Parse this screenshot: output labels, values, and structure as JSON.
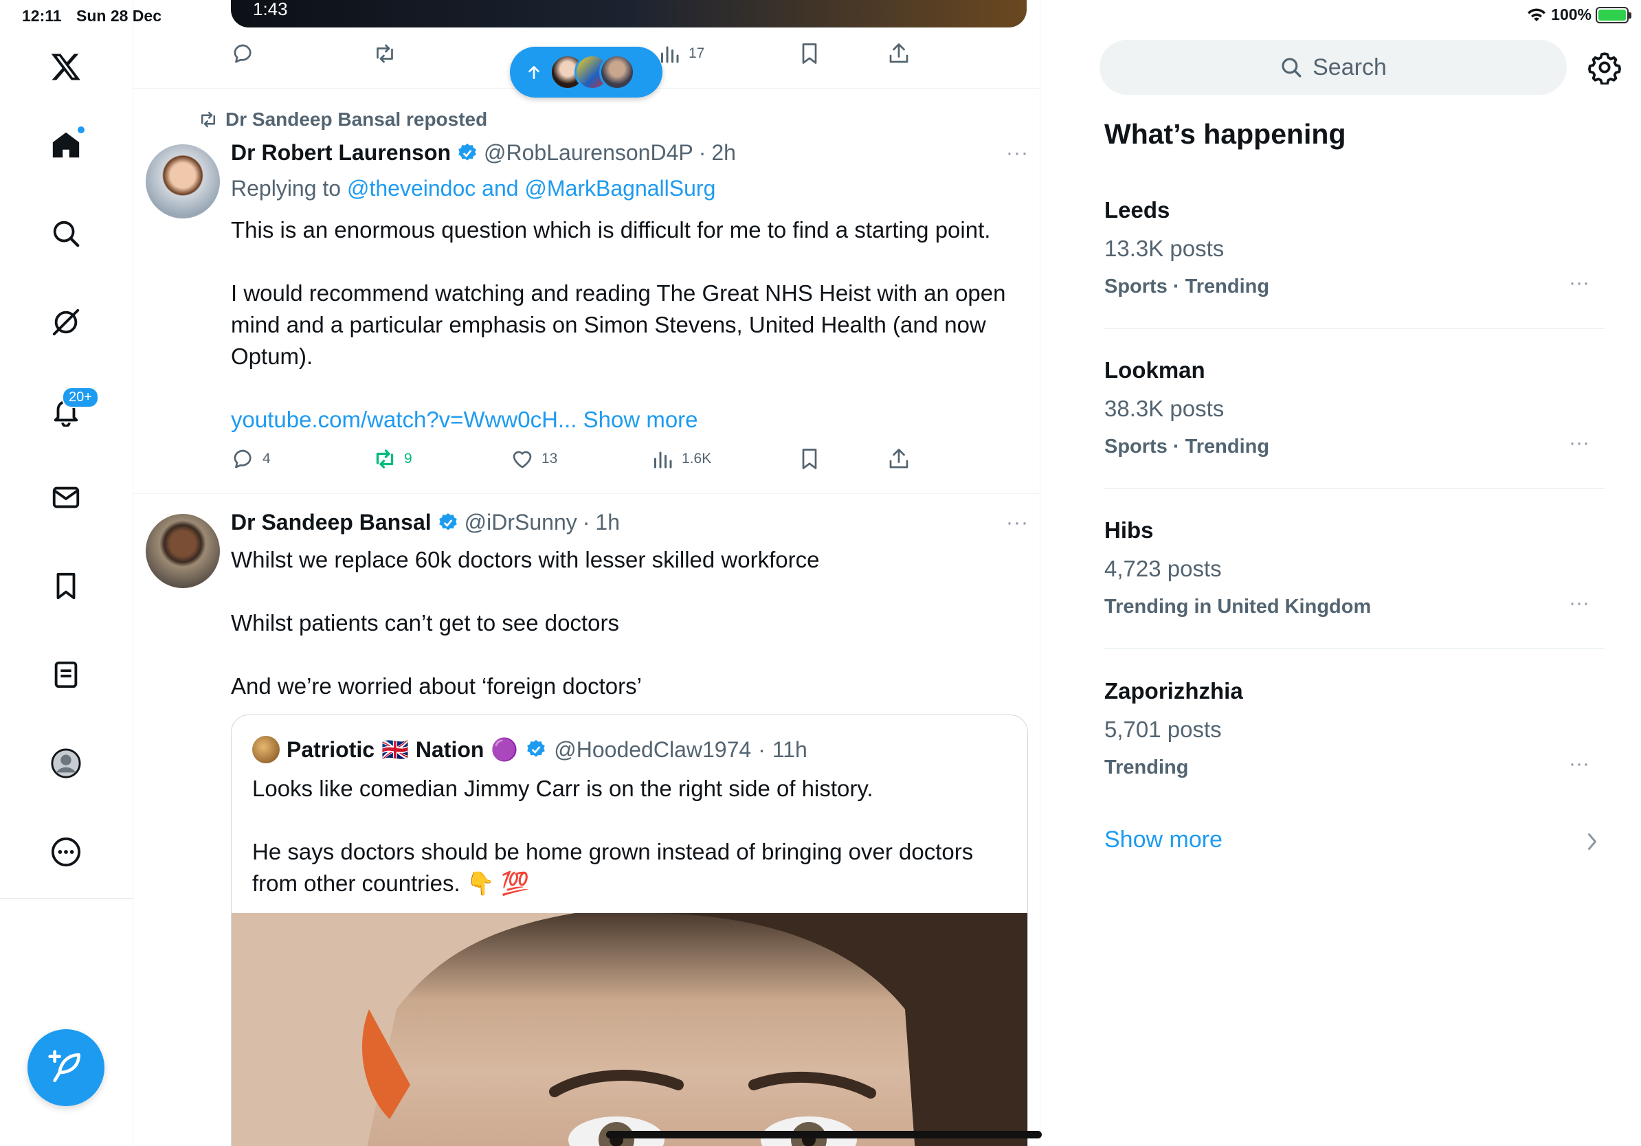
{
  "status": {
    "time": "12:11",
    "date": "Sun 28 Dec",
    "battery": "100%"
  },
  "colors": {
    "accent": "#1d9bf0",
    "retweet_active": "#00ba7c",
    "muted": "#536471"
  },
  "nav": {
    "items": [
      "x-logo-icon",
      "home-icon",
      "search-icon",
      "grok-icon",
      "bell-icon",
      "mail-icon",
      "bookmark-icon",
      "lists-icon",
      "profile-icon",
      "more-icon"
    ],
    "notifications_badge": "20+"
  },
  "video": {
    "time": "1:43"
  },
  "top_actions": {
    "views": "17"
  },
  "tweet1": {
    "reposted_by": "Dr Sandeep Bansal reposted",
    "name": "Dr Robert Laurenson",
    "handle": "@RobLaurensonD4P",
    "dot": "·",
    "time": "2h",
    "replying_prefix": "Replying to ",
    "replying_to": "@theveindoc and @MarkBagnallSurg",
    "para1": "This is an enormous question which is difficult for me to find a starting point.",
    "para2": "I would recommend watching and reading The Great NHS Heist with an open mind and a particular emphasis on Simon Stevens, United Health (and now Optum).",
    "link": "youtube.com/watch?v=Www0cH...",
    "show_more": "Show more",
    "replies": "4",
    "reposts": "9",
    "likes": "13",
    "views": "1.6K"
  },
  "tweet2": {
    "name": "Dr Sandeep Bansal",
    "handle": "@iDrSunny",
    "dot": "·",
    "time": "1h",
    "para1": "Whilst we replace 60k doctors with lesser skilled workforce",
    "para2": "Whilst patients can’t get to see doctors",
    "para3": "And we’re worried about ‘foreign doctors’",
    "quote": {
      "name_a": "Patriotic",
      "flag": "🇬🇧",
      "name_b": "Nation",
      "emoji": "🟣",
      "handle": "@HoodedClaw1974",
      "dot": "·",
      "time": "11h",
      "para1": "Looks like comedian Jimmy Carr is on the right side of history.",
      "para2": "He says doctors should be home grown instead of bringing over doctors from other countries.",
      "emojis": "👇 💯"
    }
  },
  "sidebar": {
    "search_placeholder": "Search",
    "heading": "What’s happening",
    "trends": [
      {
        "title": "Leeds",
        "count": "13.3K posts",
        "category": "Sports · Trending"
      },
      {
        "title": "Lookman",
        "count": "38.3K posts",
        "category": "Sports · Trending"
      },
      {
        "title": "Hibs",
        "count": "4,723 posts",
        "category": "Trending in United Kingdom"
      },
      {
        "title": "Zaporizhzhia",
        "count": "5,701 posts",
        "category": "Trending"
      }
    ],
    "more_glyph": "···",
    "show_more": "Show more"
  }
}
